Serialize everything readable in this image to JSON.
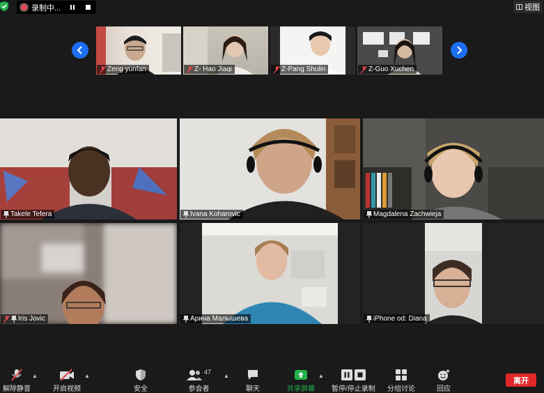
{
  "top_bar": {
    "recording_label": "录制中...",
    "view_label": "视图"
  },
  "gallery_strip": {
    "participants": [
      {
        "name": "Zeng yunfan",
        "muted": true
      },
      {
        "name": "Z- Hao Jiaqi",
        "muted": true
      },
      {
        "name": "Z-Pang Shulin",
        "muted": true
      },
      {
        "name": "Z-Guo Xuchen",
        "muted": true
      }
    ]
  },
  "tiles": [
    {
      "name": "Takele Tefera",
      "pinned": true,
      "muted": false
    },
    {
      "name": "Ivana Koharovic",
      "pinned": true,
      "muted": false
    },
    {
      "name": "Magdalena Zachwieja",
      "pinned": true,
      "muted": false
    },
    {
      "name": "Iris Jovic",
      "pinned": true,
      "muted": true
    },
    {
      "name": "Арина Малышева",
      "pinned": true,
      "muted": false
    },
    {
      "name": "iPhone od: Diana",
      "pinned": true,
      "muted": false
    }
  ],
  "toolbar": {
    "unmute_label": "解除静音",
    "video_label": "开启视频",
    "security_label": "安全",
    "participants_label": "参会者",
    "participants_count": "47",
    "chat_label": "聊天",
    "share_label": "共享屏幕",
    "record_label": "暂停/停止录制",
    "breakout_label": "分组讨论",
    "reactions_label": "回应",
    "leave_label": "离开"
  },
  "colors": {
    "accent_blue": "#1d6ff2",
    "share_green": "#22b24c",
    "leave_red": "#e02828",
    "mute_red": "#e6484d"
  }
}
